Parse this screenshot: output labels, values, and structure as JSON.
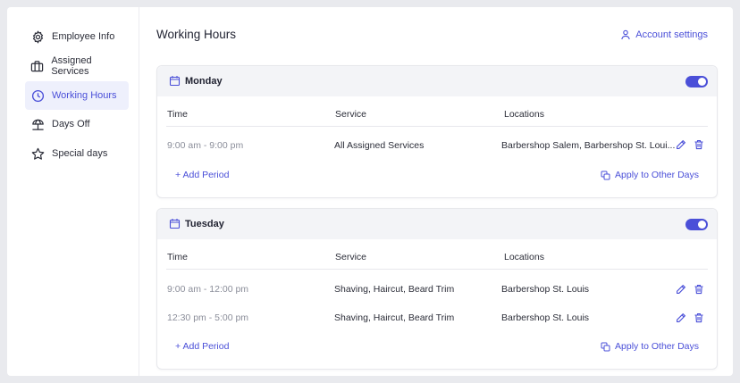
{
  "sidebar": {
    "items": [
      {
        "label": "Employee Info",
        "icon": "gear-icon",
        "active": false
      },
      {
        "label": "Assigned Services",
        "icon": "briefcase-icon",
        "active": false
      },
      {
        "label": "Working Hours",
        "icon": "clock-icon",
        "active": true
      },
      {
        "label": "Days Off",
        "icon": "beach-umbrella-icon",
        "active": false
      },
      {
        "label": "Special days",
        "icon": "star-icon",
        "active": false
      }
    ]
  },
  "header": {
    "title": "Working Hours",
    "account_settings": "Account settings"
  },
  "columns": {
    "time": "Time",
    "service": "Service",
    "locations": "Locations"
  },
  "days": [
    {
      "name": "Monday",
      "enabled": true,
      "periods": [
        {
          "time": "9:00 am - 9:00 pm",
          "service": "All Assigned Services",
          "locations": "Barbershop Salem, Barbershop St. Loui..."
        }
      ]
    },
    {
      "name": "Tuesday",
      "enabled": true,
      "periods": [
        {
          "time": "9:00 am - 12:00 pm",
          "service": "Shaving, Haircut, Beard Trim",
          "locations": "Barbershop St. Louis"
        },
        {
          "time": "12:30 pm - 5:00 pm",
          "service": "Shaving, Haircut, Beard Trim",
          "locations": "Barbershop St. Louis"
        }
      ]
    }
  ],
  "actions": {
    "add_period": "+ Add Period",
    "apply_to_other_days": "Apply to Other Days"
  },
  "colors": {
    "accent": "#4a4fd8",
    "active_bg": "#eef0fc",
    "header_bg": "#f3f4f7"
  }
}
